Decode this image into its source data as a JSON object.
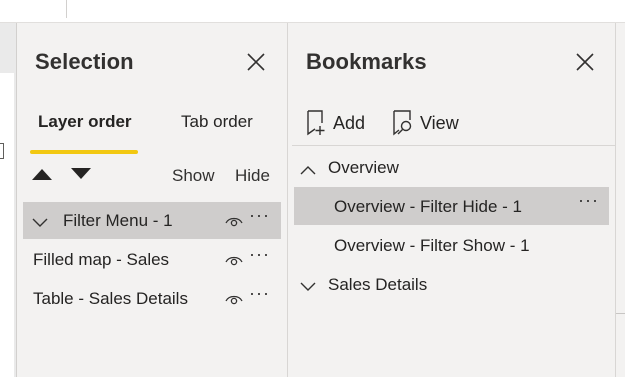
{
  "selection": {
    "title": "Selection",
    "tabs": [
      {
        "label": "Layer order",
        "active": true
      },
      {
        "label": "Tab order",
        "active": false
      }
    ],
    "columns": {
      "show": "Show",
      "hide": "Hide"
    },
    "layers": [
      {
        "label": "Filter Menu - 1",
        "expandable": true,
        "selected": true
      },
      {
        "label": "Filled map - Sales",
        "expandable": false,
        "selected": false
      },
      {
        "label": "Table - Sales Details",
        "expandable": false,
        "selected": false
      }
    ]
  },
  "bookmarks": {
    "title": "Bookmarks",
    "toolbar": {
      "add_label": "Add",
      "view_label": "View"
    },
    "groups": [
      {
        "label": "Overview",
        "expanded": true,
        "items": [
          {
            "label": "Overview - Filter Hide - 1",
            "selected": true
          },
          {
            "label": "Overview - Filter Show - 1",
            "selected": false
          }
        ]
      },
      {
        "label": "Sales Details",
        "expanded": false,
        "items": []
      }
    ]
  },
  "colors": {
    "accent": "#f2c811",
    "selected_row": "#cfcdcc",
    "pane_bg": "#f3f2f1"
  }
}
